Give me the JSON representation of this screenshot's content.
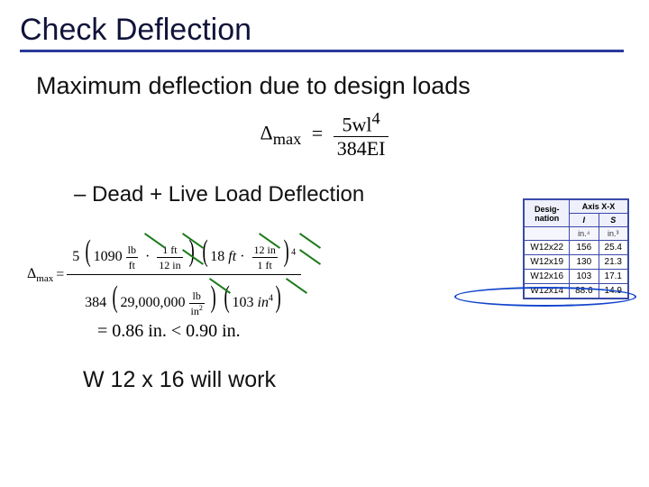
{
  "title": "Check Deflection",
  "body_intro": "Maximum deflection due to design loads",
  "formula_main": {
    "lhs": "Δ",
    "lhs_sub": "max",
    "eq": "=",
    "num": "5wl",
    "num_sup": "4",
    "den": "384EI"
  },
  "sub_bullet_dash": "–",
  "sub_bullet_text": "Dead + Live Load Deflection",
  "calc": {
    "delta": "Δ",
    "delta_sub": "max",
    "eq": "=",
    "coef": "5",
    "w_val": "1090",
    "w_unit_n": "lb",
    "w_unit_d": "ft",
    "conv1_n": "1 ft",
    "conv1_d": "12 in",
    "len_val": "18",
    "len_unit": "ft",
    "conv2_n": "12 in",
    "conv2_d": "1 ft",
    "len_pow": "4",
    "den_const": "384",
    "E_val": "29,000,000",
    "E_unit_n": "lb",
    "E_unit_d": "in",
    "E_unit_pow": "2",
    "I_val": "103",
    "I_unit": "in",
    "I_unit_pow": "4"
  },
  "result_lhs": "= 0.86 in.",
  "result_op": "<",
  "result_rhs": "0.90 in.",
  "conclusion": "W 12 x 16 will work",
  "table": {
    "h_design": "Desig-\nnation",
    "h_axis": "Axis X-X",
    "h_I": "I",
    "h_S": "S",
    "u_I": "in.⁴",
    "u_S": "in.³",
    "rows": [
      {
        "d": "W12x22",
        "i": "156",
        "s": "25.4"
      },
      {
        "d": "W12x19",
        "i": "130",
        "s": "21.3"
      },
      {
        "d": "W12x16",
        "i": "103",
        "s": "17.1"
      },
      {
        "d": "W12x14",
        "i": "88.6",
        "s": "14.9"
      }
    ]
  }
}
